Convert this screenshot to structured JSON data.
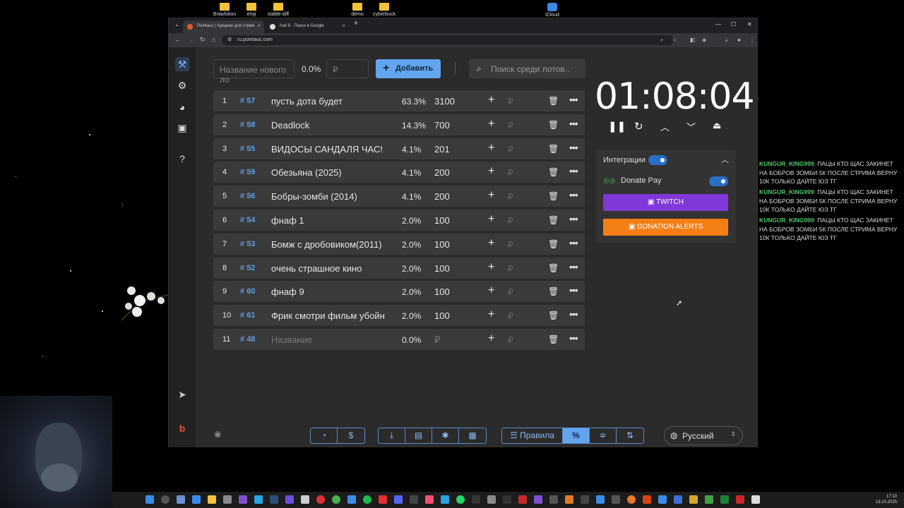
{
  "desktop": {
    "icons": [
      "Brawlstion",
      "emji",
      "stable-diff",
      "demo",
      "cyberbuck",
      "iCloud Notes"
    ]
  },
  "browser": {
    "tabs": [
      {
        "title": "Pointauc | Аукцион для стрим",
        "active": true
      },
      {
        "title": "fnaf 9 - Поиск в Google",
        "active": false
      }
    ],
    "url": "ru.pointauc.com"
  },
  "app": {
    "new_lot_placeholder": "Название нового ло",
    "percent_value": "0.0%",
    "amount_placeholder": "₽",
    "add_button": "Добавить",
    "search_placeholder": "Поиск среди лотов..",
    "lots": [
      {
        "num": "1",
        "id": "57",
        "name": "пусть дота будет",
        "pct": "63.3%",
        "amount": "3100"
      },
      {
        "num": "2",
        "id": "58",
        "name": "Deadlock",
        "pct": "14.3%",
        "amount": "700"
      },
      {
        "num": "3",
        "id": "55",
        "name": "ВИДОСЫ САНДАЛЯ ЧАС!",
        "pct": "4.1%",
        "amount": "201"
      },
      {
        "num": "4",
        "id": "59",
        "name": "Обезьяна (2025)",
        "pct": "4.1%",
        "amount": "200"
      },
      {
        "num": "5",
        "id": "56",
        "name": "Бобры-зомби (2014)",
        "pct": "4.1%",
        "amount": "200"
      },
      {
        "num": "6",
        "id": "54",
        "name": "фнаф 1",
        "pct": "2.0%",
        "amount": "100"
      },
      {
        "num": "7",
        "id": "53",
        "name": "Бомж с дробовиком(2011)",
        "pct": "2.0%",
        "amount": "100"
      },
      {
        "num": "8",
        "id": "52",
        "name": "очень страшное кино",
        "pct": "2.0%",
        "amount": "100"
      },
      {
        "num": "9",
        "id": "60",
        "name": "фнаф 9",
        "pct": "2.0%",
        "amount": "100"
      },
      {
        "num": "10",
        "id": "61",
        "name": "Фрик смотри фильм убойн",
        "pct": "2.0%",
        "amount": "100"
      },
      {
        "num": "11",
        "id": "48",
        "name": "Название",
        "pct": "0.0%",
        "amount": "₽"
      }
    ],
    "currency_symbol": "₽",
    "timer": "01:08:04",
    "integrations": {
      "label": "Интеграции",
      "donate_pay": "Donate Pay",
      "twitch": "TWITCH",
      "donation_alerts": "DONATION ALERTS"
    },
    "bottom": {
      "rules": "Правила",
      "language": "Русский"
    }
  },
  "chat": [
    {
      "user": "KUNGUR_KING999",
      "text": "ПАЦЫ КТО ЩАС ЗАКИНЕТ НА БОБРОВ ЗОМБИ 5К ПОСЛЕ СТРИМА ВЕРНУ 10К ТОЛЬКО ДАЙТЕ ЮЗ ТГ"
    },
    {
      "user": "KUNGUR_KING999",
      "text": "ПАЦЫ КТО ЩАС ЗАКИНЕТ НА БОБРОВ ЗОМБИ 5К ПОСЛЕ СТРИМА ВЕРНУ 10К ТОЛЬКО ДАЙТЕ ЮЗ ТГ"
    },
    {
      "user": "KUNGUR_KING999",
      "text": "ПАЦЫ КТО ЩАС ЗАКИНЕТ НА БОБРОВ ЗОМБИ 5К ПОСЛЕ СТРИМА ВЕРНУ 10К ТОЛЬКО ДАЙТЕ ЮЗ ТГ"
    }
  ],
  "taskbar": {
    "time": "17:10",
    "date": "13.10.2025"
  },
  "colors": {
    "accent": "#63a4ee",
    "twitch": "#8038d9",
    "donation_alerts": "#f47f16",
    "chat_user": "#4ec96c"
  }
}
